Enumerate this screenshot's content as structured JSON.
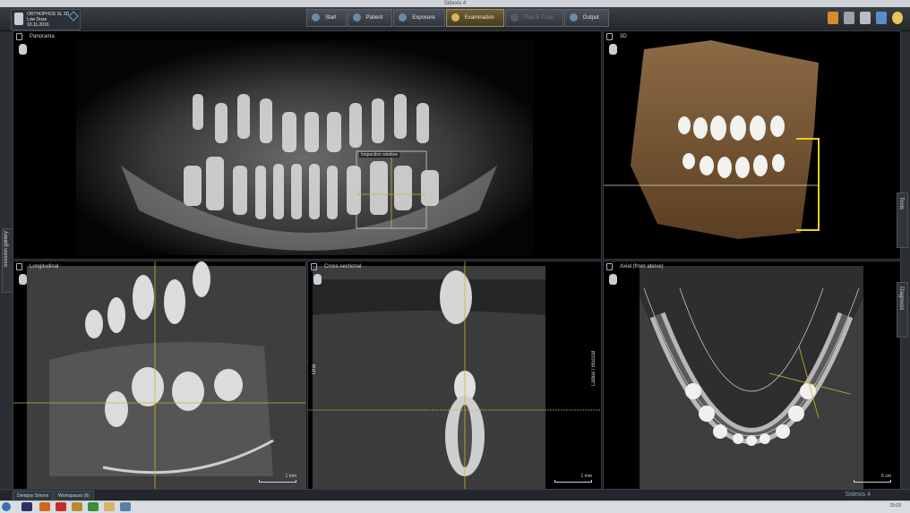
{
  "window": {
    "title": "Sidexis 4"
  },
  "patient": {
    "line1": "ORTHOPHOS SL 3D",
    "line2": "Low Dose",
    "line3": "10.11.2016"
  },
  "workflow": [
    {
      "label": "Start",
      "state": "done"
    },
    {
      "label": "Patient",
      "state": "done"
    },
    {
      "label": "Exposure",
      "state": "done"
    },
    {
      "label": "Examination",
      "state": "active"
    },
    {
      "label": "Plan & Treat",
      "state": "disabled"
    },
    {
      "label": "Output",
      "state": "done"
    }
  ],
  "toolbar_icons": [
    "export-icon",
    "tools-icon",
    "trash-icon",
    "monitor-icon",
    "help-icon"
  ],
  "panels": {
    "panorama": {
      "title": "Panorama",
      "inspection_label": "Inspection window"
    },
    "view3d": {
      "title": "3D"
    },
    "longitudinal": {
      "title": "Longitudinal",
      "scale": "1 mm"
    },
    "cross": {
      "title": "Cross-sectional",
      "left_label": "Oral",
      "right_label": "Labial / Buccal",
      "scale": "1 mm"
    },
    "axial": {
      "title": "Axial (from above)",
      "scale": "5 cm"
    }
  },
  "side_tabs": {
    "left": "Session gallery",
    "right_top": "Tools",
    "right_bottom": "Diagnosis"
  },
  "status": {
    "tab1": "Dempsy Smons",
    "tab2": "Workspaces (6)",
    "brand": "Sidexis 4"
  },
  "taskbar": {
    "time": "15:03"
  },
  "colors": {
    "accent": "#d8b45a",
    "crosshair": "#cbb52a",
    "background": "#141619"
  }
}
